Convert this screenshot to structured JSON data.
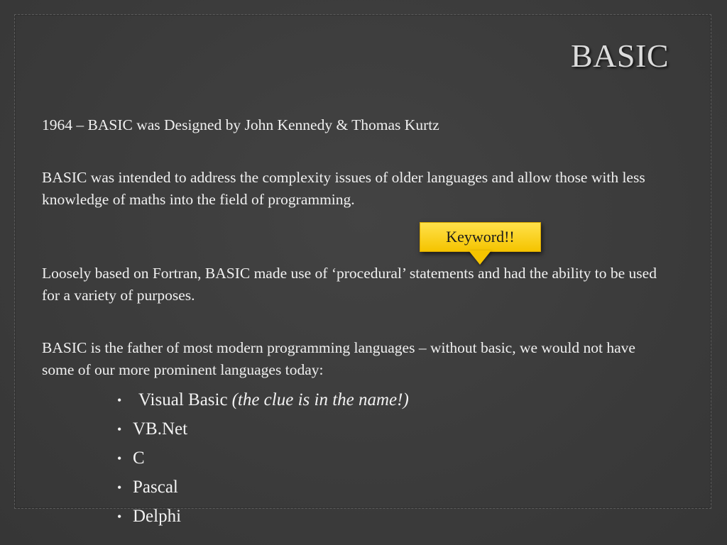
{
  "slide": {
    "title": "BASIC",
    "paragraphs": [
      "1964 – BASIC was Designed by John Kennedy & Thomas Kurtz",
      "BASIC was intended to address the complexity issues of older languages and allow those with less knowledge of maths into the field of programming.",
      "Loosely based on Fortran, BASIC made use of ‘procedural’ statements and had the ability to be used for a variety of purposes.",
      "BASIC is the father of most modern programming languages – without basic, we would not have some of our more prominent languages today:"
    ],
    "bullet_symbol": "•",
    "bullets": [
      {
        "text": "Visual Basic",
        "note": "(the clue is in the name!)"
      },
      {
        "text": "VB.Net"
      },
      {
        "text": "C"
      },
      {
        "text": "Pascal"
      },
      {
        "text": "Delphi"
      }
    ],
    "callout": {
      "text": "Keyword!!"
    }
  },
  "colors": {
    "background": "#3a3a3a",
    "text": "#f0f0f0",
    "callout": "#f5c400"
  }
}
